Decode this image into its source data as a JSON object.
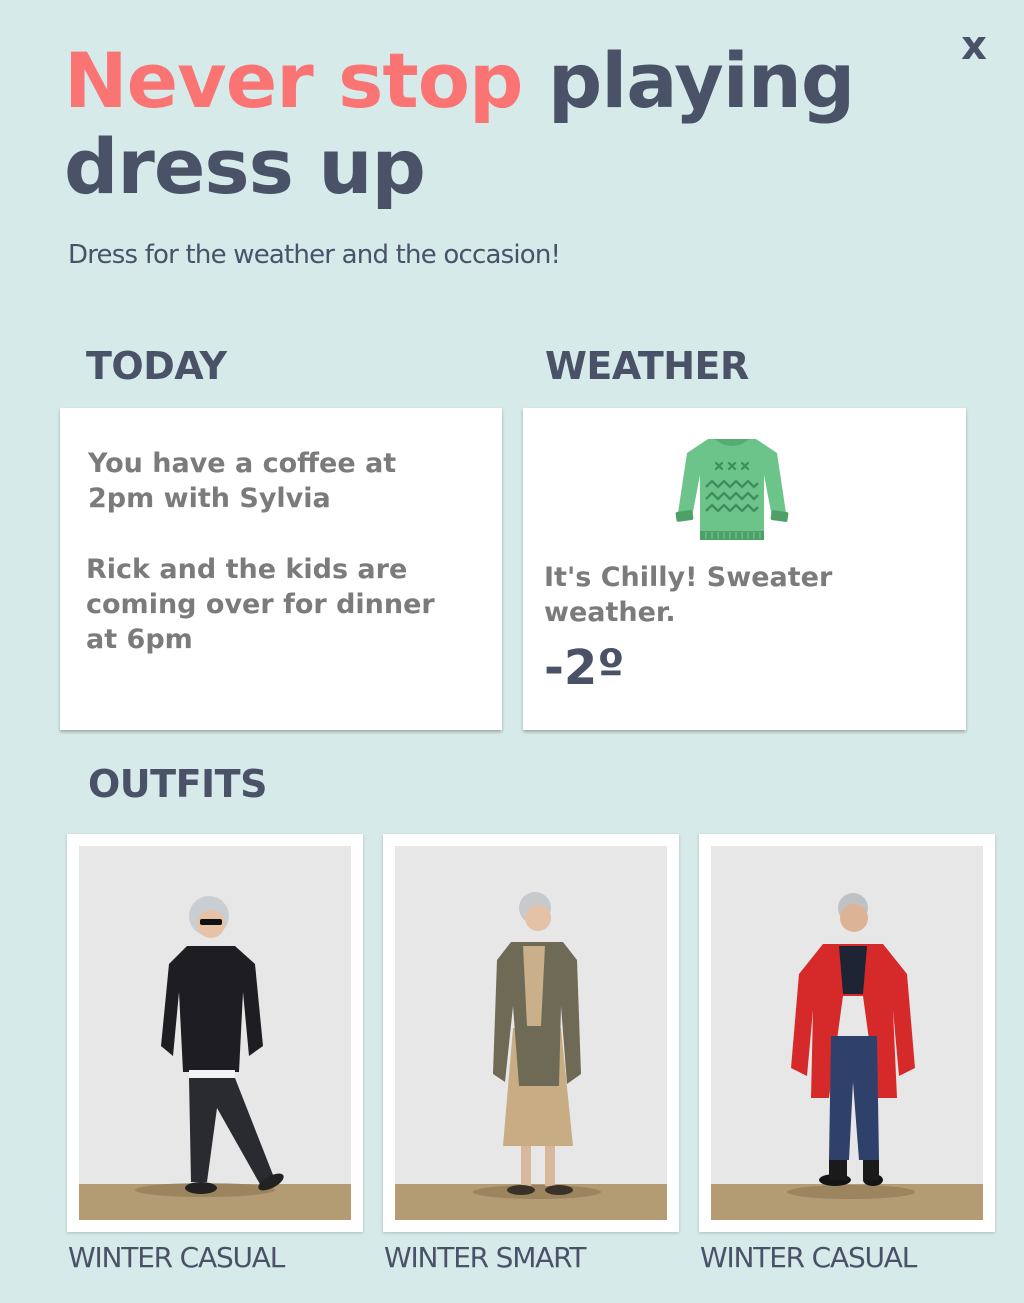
{
  "close_label": "x",
  "headline": {
    "accent": "Never stop",
    "rest": " playing dress up"
  },
  "subtitle": "Dress for the weather and the occasion!",
  "today": {
    "title": "TODAY",
    "events": [
      "You have a coffee at 2pm with Sylvia",
      "Rick and the kids are coming over for dinner at 6pm"
    ]
  },
  "weather": {
    "title": "WEATHER",
    "icon": "sweater-icon",
    "text": "It's Chilly! Sweater weather.",
    "temperature": "-2º"
  },
  "outfits": {
    "title": "OUTFITS",
    "items": [
      {
        "label": "WINTER CASUAL"
      },
      {
        "label": "WINTER SMART"
      },
      {
        "label": "WINTER CASUAL"
      }
    ]
  },
  "colors": {
    "background": "#d6eaea",
    "accent": "#fb7474",
    "heading": "#4a5268",
    "body_text": "#7b7b7b",
    "sweater_green": "#6cc48a"
  }
}
